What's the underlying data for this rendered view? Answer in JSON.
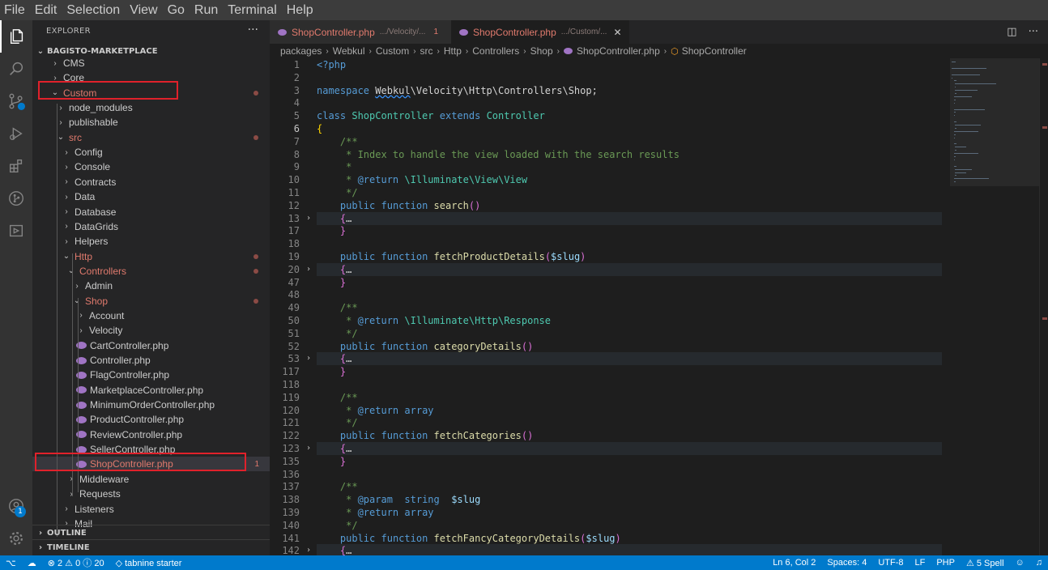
{
  "menu": [
    "File",
    "Edit",
    "Selection",
    "View",
    "Go",
    "Run",
    "Terminal",
    "Help"
  ],
  "activity": {
    "icons": [
      "files-icon",
      "search-icon",
      "source-control-icon",
      "run-debug-icon",
      "extensions-icon",
      "git-graph-icon",
      "remote-explorer-icon"
    ],
    "account_badge": "1"
  },
  "explorer": {
    "title": "EXPLORER",
    "more": "···",
    "root": "BAGISTO-MARKETPLACE",
    "tree": [
      {
        "label": "CMS",
        "depth": 1,
        "type": "folder",
        "open": false
      },
      {
        "label": "Core",
        "depth": 1,
        "type": "folder",
        "open": false
      },
      {
        "label": "Custom",
        "depth": 1,
        "type": "folder",
        "open": true,
        "modified": true
      },
      {
        "label": "node_modules",
        "depth": 2,
        "type": "folder",
        "open": false
      },
      {
        "label": "publishable",
        "depth": 2,
        "type": "folder",
        "open": false
      },
      {
        "label": "src",
        "depth": 2,
        "type": "folder",
        "open": true,
        "modified": true
      },
      {
        "label": "Config",
        "depth": 3,
        "type": "folder",
        "open": false
      },
      {
        "label": "Console",
        "depth": 3,
        "type": "folder",
        "open": false
      },
      {
        "label": "Contracts",
        "depth": 3,
        "type": "folder",
        "open": false
      },
      {
        "label": "Data",
        "depth": 3,
        "type": "folder",
        "open": false
      },
      {
        "label": "Database",
        "depth": 3,
        "type": "folder",
        "open": false
      },
      {
        "label": "DataGrids",
        "depth": 3,
        "type": "folder",
        "open": false
      },
      {
        "label": "Helpers",
        "depth": 3,
        "type": "folder",
        "open": false
      },
      {
        "label": "Http",
        "depth": 3,
        "type": "folder",
        "open": true,
        "modified": true
      },
      {
        "label": "Controllers",
        "depth": 4,
        "type": "folder",
        "open": true,
        "modified": true
      },
      {
        "label": "Admin",
        "depth": 5,
        "type": "folder",
        "open": false
      },
      {
        "label": "Shop",
        "depth": 5,
        "type": "folder",
        "open": true,
        "modified": true
      },
      {
        "label": "Account",
        "depth": 6,
        "type": "folder",
        "open": false
      },
      {
        "label": "Velocity",
        "depth": 6,
        "type": "folder",
        "open": false
      },
      {
        "label": "CartController.php",
        "depth": 6,
        "type": "file"
      },
      {
        "label": "Controller.php",
        "depth": 6,
        "type": "file"
      },
      {
        "label": "FlagController.php",
        "depth": 6,
        "type": "file"
      },
      {
        "label": "MarketplaceController.php",
        "depth": 6,
        "type": "file"
      },
      {
        "label": "MinimumOrderController.php",
        "depth": 6,
        "type": "file"
      },
      {
        "label": "ProductController.php",
        "depth": 6,
        "type": "file"
      },
      {
        "label": "ReviewController.php",
        "depth": 6,
        "type": "file"
      },
      {
        "label": "SellerController.php",
        "depth": 6,
        "type": "file"
      },
      {
        "label": "ShopController.php",
        "depth": 6,
        "type": "file",
        "modified": true,
        "selected": true,
        "count": "1"
      },
      {
        "label": "Middleware",
        "depth": 4,
        "type": "folder",
        "open": false
      },
      {
        "label": "Requests",
        "depth": 4,
        "type": "folder",
        "open": false
      },
      {
        "label": "Listeners",
        "depth": 3,
        "type": "folder",
        "open": false
      },
      {
        "label": "Mail",
        "depth": 3,
        "type": "folder",
        "open": false
      }
    ],
    "outline": "OUTLINE",
    "timeline": "TIMELINE"
  },
  "tabs": [
    {
      "label": "ShopController.php",
      "path": ".../Velocity/...",
      "count": "1",
      "active": false
    },
    {
      "label": "ShopController.php",
      "path": ".../Custom/...",
      "count": "",
      "active": true,
      "close": "✕"
    }
  ],
  "breadcrumb": {
    "parts": [
      "packages",
      "Webkul",
      "Custom",
      "src",
      "Http",
      "Controllers",
      "Shop"
    ],
    "file": "ShopController.php",
    "symbol": "ShopController"
  },
  "code": [
    {
      "n": "1",
      "t": "<?php"
    },
    {
      "n": "2",
      "t": ""
    },
    {
      "n": "3",
      "t": "namespace Webkul\\Velocity\\Http\\Controllers\\Shop;"
    },
    {
      "n": "4",
      "t": ""
    },
    {
      "n": "5",
      "t": "class ShopController extends Controller"
    },
    {
      "n": "6",
      "t": "{"
    },
    {
      "n": "7",
      "t": "    /**"
    },
    {
      "n": "8",
      "t": "     * Index to handle the view loaded with the search results"
    },
    {
      "n": "9",
      "t": "     *"
    },
    {
      "n": "10",
      "t": "     * @return \\Illuminate\\View\\View"
    },
    {
      "n": "11",
      "t": "     */"
    },
    {
      "n": "12",
      "t": "    public function search()"
    },
    {
      "n": "13",
      "t": "    {…"
    },
    {
      "n": "17",
      "t": "    }"
    },
    {
      "n": "18",
      "t": ""
    },
    {
      "n": "19",
      "t": "    public function fetchProductDetails($slug)"
    },
    {
      "n": "20",
      "t": "    {…"
    },
    {
      "n": "47",
      "t": "    }"
    },
    {
      "n": "48",
      "t": ""
    },
    {
      "n": "49",
      "t": "    /**"
    },
    {
      "n": "50",
      "t": "     * @return \\Illuminate\\Http\\Response"
    },
    {
      "n": "51",
      "t": "     */"
    },
    {
      "n": "52",
      "t": "    public function categoryDetails()"
    },
    {
      "n": "53",
      "t": "    {…"
    },
    {
      "n": "117",
      "t": "    }"
    },
    {
      "n": "118",
      "t": ""
    },
    {
      "n": "119",
      "t": "    /**"
    },
    {
      "n": "120",
      "t": "     * @return array"
    },
    {
      "n": "121",
      "t": "     */"
    },
    {
      "n": "122",
      "t": "    public function fetchCategories()"
    },
    {
      "n": "123",
      "t": "    {…"
    },
    {
      "n": "135",
      "t": "    }"
    },
    {
      "n": "136",
      "t": ""
    },
    {
      "n": "137",
      "t": "    /**"
    },
    {
      "n": "138",
      "t": "     * @param  string  $slug"
    },
    {
      "n": "139",
      "t": "     * @return array"
    },
    {
      "n": "140",
      "t": "     */"
    },
    {
      "n": "141",
      "t": "    public function fetchFancyCategoryDetails($slug)"
    },
    {
      "n": "142",
      "t": "    {…"
    }
  ],
  "status": {
    "remote": "⚡",
    "problems_errors": "2",
    "problems_warnings": "0",
    "problems_info": "20",
    "tabnine": "tabnine starter",
    "position": "Ln 6, Col 2",
    "spaces": "Spaces: 4",
    "encoding": "UTF-8",
    "eol": "LF",
    "language": "PHP",
    "spell": "5 Spell"
  },
  "colors": {
    "statusbar": "#007acc",
    "modified": "#e07a6d",
    "highlight_box": "#e0212b"
  }
}
